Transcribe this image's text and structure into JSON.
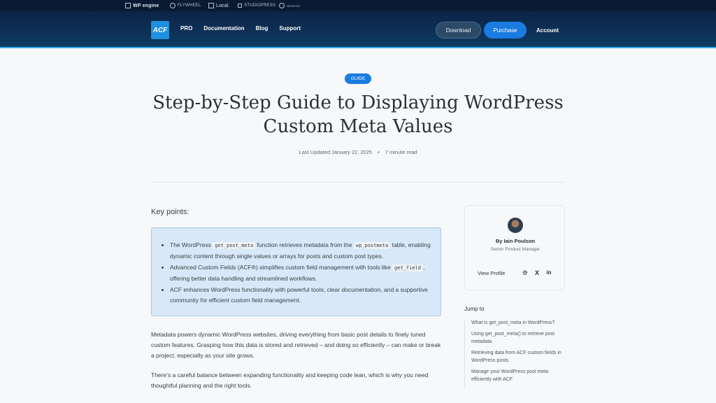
{
  "brand_bar": {
    "items": [
      "WP engine",
      "FLYWHEEL",
      "Local",
      "STUDIOPRESS",
      "GENESIS"
    ]
  },
  "header": {
    "logo": "ACF",
    "nav": [
      "PRO",
      "Documentation",
      "Blog",
      "Support"
    ],
    "download": "Download",
    "purchase": "Purchase",
    "account": "Account",
    "accent_color": "#1a7be0"
  },
  "article": {
    "badge": "GUIDE",
    "title": "Step-by-Step Guide to Displaying WordPress Custom Meta Values",
    "updated": "Last Updated January 22, 2025",
    "separator": "•",
    "read_time": "7 minute read",
    "key_points_title": "Key points:",
    "key_points": [
      {
        "a": "The WordPress ",
        "code1": "get_post_meta",
        "b": " function retrieves metadata from the ",
        "code2": "wp_postmeta",
        "c": " table, enabling dynamic content through single values or arrays for posts and custom post types."
      },
      {
        "a": "Advanced Custom Fields (ACF®) simplifies custom field management with tools like ",
        "code1": "get_field",
        "b": ", offering better data handling and streamlined workflows."
      },
      {
        "a": "ACF enhances WordPress functionality with powerful tools, clear documentation, and a supportive community for efficient custom field management."
      }
    ],
    "paragraphs": [
      "Metadata powers dynamic WordPress websites, driving everything from basic post details to finely tuned custom features. Grasping how this data is stored and retrieved – and doing so efficiently – can make or break a project, especially as your site grows.",
      "There’s a careful balance between expanding functionality and keeping code lean, which is why you need thoughtful planning and the right tools."
    ]
  },
  "author": {
    "name": "By Iain Poulson",
    "role": "Senior Product Manager",
    "view_profile": "View Profile"
  },
  "jump_to": {
    "title": "Jump to",
    "items": [
      "What is get_post_meta in WordPress?",
      "Using get_post_meta() to retrieve post metadata",
      "Retrieving data from ACF custom fields in WordPress posts",
      "Manage your WordPress post meta efficiently with ACF"
    ]
  }
}
